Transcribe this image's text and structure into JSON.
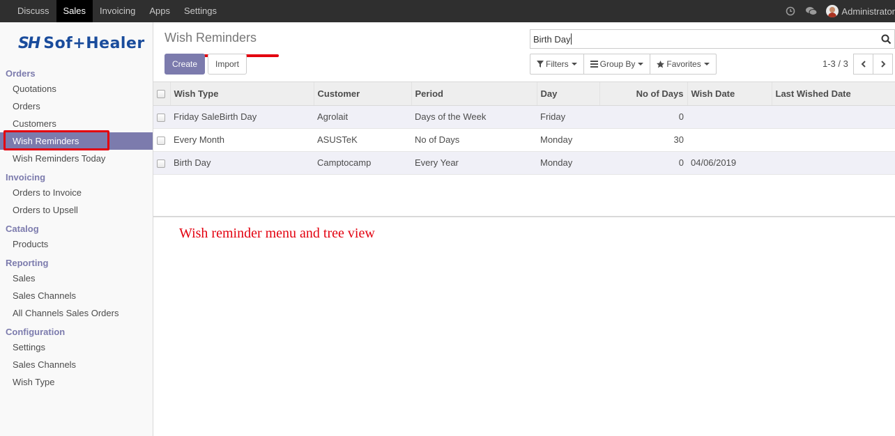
{
  "topbar": {
    "menu": [
      "Discuss",
      "Sales",
      "Invoicing",
      "Apps",
      "Settings"
    ],
    "active_menu": "Sales",
    "user": "Administrator"
  },
  "brand": {
    "mark": "SH",
    "name": "Sof+Healer",
    "color": "#1a4c9c"
  },
  "sidebar": {
    "sections": [
      {
        "title": "Orders",
        "items": [
          "Quotations",
          "Orders",
          "Customers",
          "Wish Reminders",
          "Wish Reminders Today"
        ]
      },
      {
        "title": "Invoicing",
        "items": [
          "Orders to Invoice",
          "Orders to Upsell"
        ]
      },
      {
        "title": "Catalog",
        "items": [
          "Products"
        ]
      },
      {
        "title": "Reporting",
        "items": [
          "Sales",
          "Sales Channels",
          "All Channels Sales Orders"
        ]
      },
      {
        "title": "Configuration",
        "items": [
          "Settings",
          "Sales Channels",
          "Wish Type"
        ]
      }
    ],
    "active_item": "Wish Reminders"
  },
  "control_panel": {
    "breadcrumb": "Wish Reminders",
    "create_label": "Create",
    "import_label": "Import",
    "search_value": "Birth Day",
    "filters_label": "Filters",
    "groupby_label": "Group By",
    "favorites_label": "Favorites",
    "pager": "1-3 / 3"
  },
  "table": {
    "columns": [
      "Wish Type",
      "Customer",
      "Period",
      "Day",
      "No of Days",
      "Wish Date",
      "Last Wished Date"
    ],
    "rows": [
      [
        "Friday SaleBirth Day",
        "Agrolait",
        "Days of the Week",
        "Friday",
        "0",
        "",
        ""
      ],
      [
        "Every Month",
        "ASUSTeK",
        "No of Days",
        "Monday",
        "30",
        "",
        ""
      ],
      [
        "Birth Day",
        "Camptocamp",
        "Every Year",
        "Monday",
        "0",
        "04/06/2019",
        ""
      ]
    ]
  },
  "annotation": "Wish reminder menu and tree view",
  "colors": {
    "accent": "#7c7bad",
    "highlight": "#e3000f",
    "topbar": "#2f2f2f"
  }
}
